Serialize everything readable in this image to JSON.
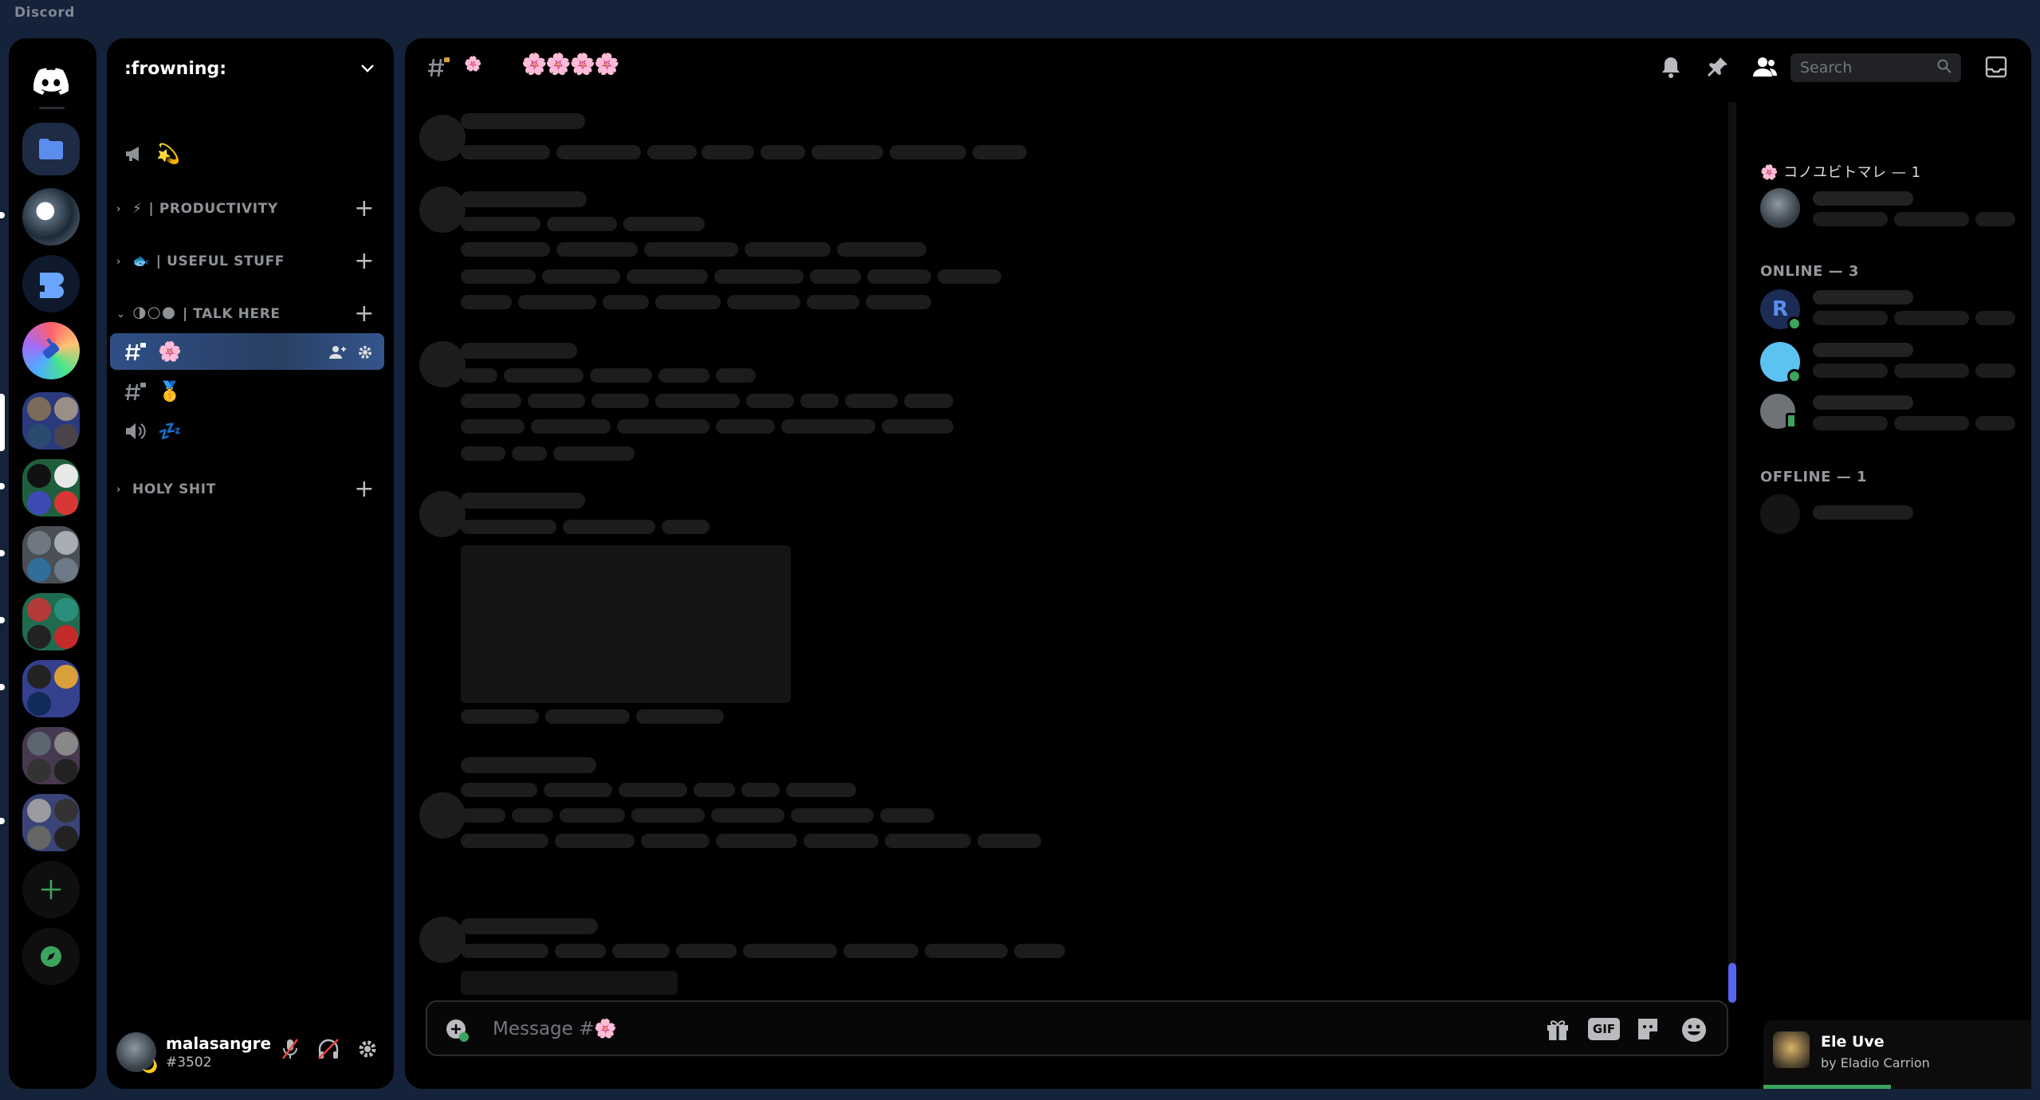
{
  "app": {
    "title": "Discord"
  },
  "server": {
    "name": ":frowning:"
  },
  "channels": {
    "announcement_emoji": "💫",
    "categories": [
      {
        "label": "| PRODUCTIVITY",
        "emoji": "⚡"
      },
      {
        "label": "| USEFUL STUFF",
        "emoji": "🐟"
      },
      {
        "label": "| TALK HERE",
        "emoji": "🌗🌕🌑"
      },
      {
        "label": "HOLY SHIT",
        "emoji": ""
      }
    ],
    "selected_emoji": "🌸",
    "medal_emoji": "🥇",
    "voice_emoji": "💤"
  },
  "header": {
    "channel_emoji": "🌸",
    "topic": "🌸🌸🌸🌸"
  },
  "search": {
    "placeholder": "Search"
  },
  "members": {
    "role_label": "🌸 コノユビトマレ — 1",
    "online_label": "ONLINE — 3",
    "offline_label": "OFFLINE — 1"
  },
  "composer": {
    "placeholder": "Message #🌸",
    "gif_label": "GIF"
  },
  "user": {
    "name": "malasangre",
    "tag": "#3502"
  },
  "now_playing": {
    "title": "Ele Uve",
    "artist": "by Eladio Carrion"
  },
  "colors": {
    "accent": "#5865f2",
    "online": "#3ba55d",
    "selected_channel": "#2e4f86",
    "background": "#15233a"
  }
}
